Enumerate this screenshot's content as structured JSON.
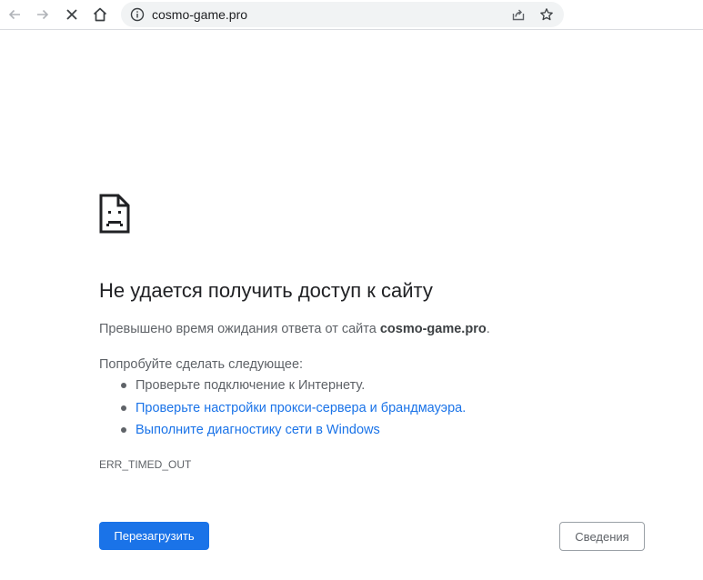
{
  "toolbar": {
    "back_icon": "arrow-left-icon",
    "forward_icon": "arrow-right-icon",
    "stop_icon": "close-icon",
    "home_icon": "home-icon",
    "url": "cosmo-game.pro",
    "info_icon": "info-circle-icon",
    "share_icon": "share-icon",
    "bookmark_icon": "star-icon"
  },
  "error_page": {
    "icon": "sad-page-icon",
    "heading": "Не удается получить доступ к сайту",
    "summary_prefix": "Превышено время ожидания ответа от сайта ",
    "summary_site": "cosmo-game.pro",
    "summary_suffix": ".",
    "suggestions_heading": "Попробуйте сделать следующее:",
    "suggestions": [
      {
        "text": "Проверьте подключение к Интернету.",
        "link": false
      },
      {
        "text": "Проверьте настройки прокси-сервера и брандмауэра.",
        "link": true
      },
      {
        "text": "Выполните диагностику сети в Windows",
        "link": true
      }
    ],
    "error_code": "ERR_TIMED_OUT",
    "reload_label": "Перезагрузить",
    "details_label": "Сведения"
  },
  "colors": {
    "accent": "#1a73e8",
    "text_primary": "#202124",
    "text_secondary": "#5f6368"
  }
}
